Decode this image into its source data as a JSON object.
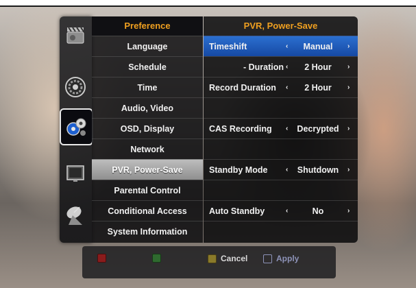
{
  "icons": [
    {
      "name": "clapperboard-icon",
      "selected": false
    },
    {
      "name": "dartboard-icon",
      "selected": false
    },
    {
      "name": "media-reels-icon",
      "selected": true
    },
    {
      "name": "tv-screen-icon",
      "selected": false
    },
    {
      "name": "satellite-dish-icon",
      "selected": false
    }
  ],
  "menu": {
    "header": "Preference",
    "items": [
      "Language",
      "Schedule",
      "Time",
      "Audio, Video",
      "OSD, Display",
      "Network",
      "PVR, Power-Save",
      "Parental Control",
      "Conditional Access",
      "System Information"
    ],
    "selected_index": 6
  },
  "panel": {
    "header": "PVR, Power-Save",
    "rows": [
      {
        "label": "Timeshift",
        "value": "Manual",
        "left_arrow": "‹",
        "right_arrow": "›",
        "highlight": true
      },
      {
        "label": "- Duration",
        "value": "2 Hour",
        "left_arrow": "‹",
        "right_arrow": "›"
      },
      {
        "label": "Record Duration",
        "value": "2 Hour",
        "left_arrow": "‹",
        "right_arrow": "›"
      },
      {
        "label": "",
        "value": ""
      },
      {
        "label": "CAS Recording",
        "value": "Decrypted",
        "left_arrow": "‹",
        "right_arrow": "›"
      },
      {
        "label": "",
        "value": ""
      },
      {
        "label": "Standby Mode",
        "value": "Shutdown",
        "left_arrow": "‹",
        "right_arrow": "›"
      },
      {
        "label": "",
        "value": ""
      },
      {
        "label": "Auto Standby",
        "value": "No",
        "left_arrow": "‹",
        "right_arrow": "›"
      },
      {
        "label": "",
        "value": ""
      }
    ]
  },
  "footer": {
    "red_label": "",
    "green_label": "",
    "cancel_label": "Cancel",
    "apply_label": "Apply"
  },
  "colors": {
    "accent": "#f0a020",
    "highlight": "#1f5bbf",
    "selected_menu": "#a9a9a9",
    "cancel_text": "#d9d9d9",
    "apply_text": "#8d93b8"
  }
}
